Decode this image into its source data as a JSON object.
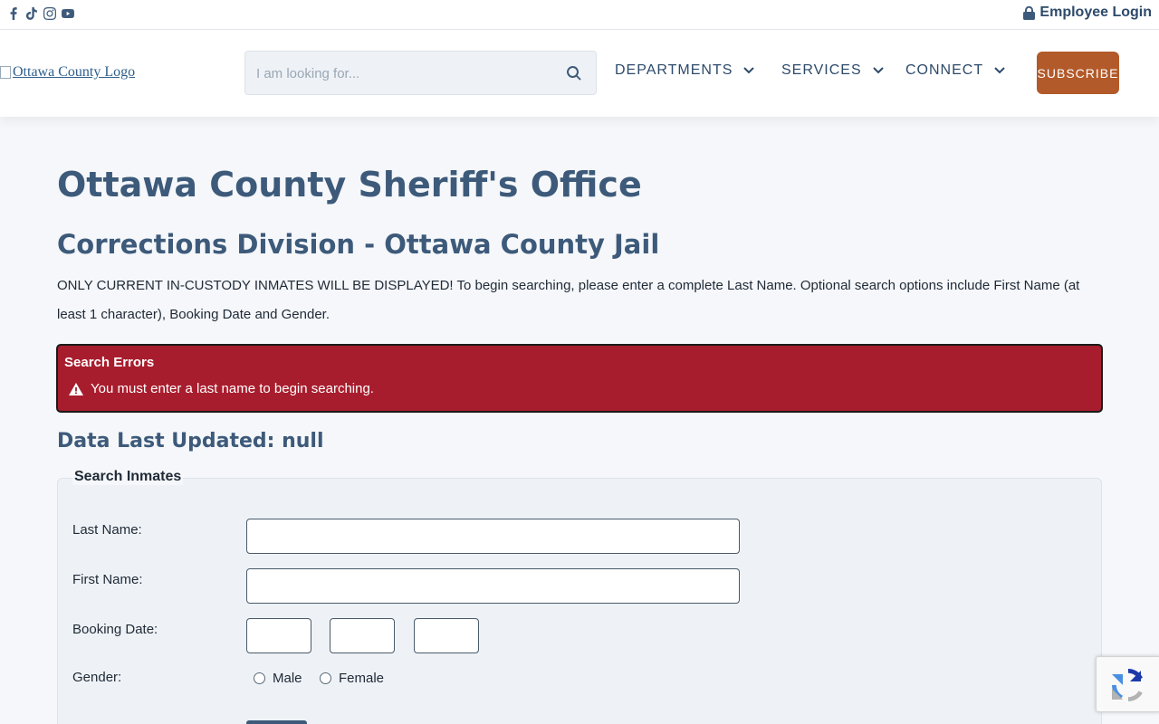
{
  "topbar": {
    "social_icons": [
      "facebook-icon",
      "tiktok-icon",
      "instagram-icon",
      "youtube-icon"
    ],
    "employee_login": "Employee Login"
  },
  "header": {
    "logo_alt": "Ottawa County Logo",
    "search_placeholder": "I am looking for...",
    "nav": [
      {
        "label": "DEPARTMENTS"
      },
      {
        "label": "SERVICES"
      },
      {
        "label": "CONNECT"
      }
    ],
    "subscribe": "SUBSCRIBE"
  },
  "main": {
    "title": "Ottawa County Sheriff's Office",
    "subtitle": "Corrections Division - Ottawa County Jail",
    "intro": "ONLY CURRENT IN-CUSTODY INMATES WILL BE DISPLAYED! To begin searching, please enter a complete Last Name. Optional search options include First Name (at least 1 character), Booking Date and Gender.",
    "error": {
      "title": "Search Errors",
      "message": "You must enter a last name to begin searching."
    },
    "updated": "Data Last Updated: null",
    "form": {
      "legend": "Search Inmates",
      "last_name_label": "Last Name:",
      "last_name_value": "",
      "first_name_label": "First Name:",
      "first_name_value": "",
      "booking_date_label": "Booking Date:",
      "gender_label": "Gender:",
      "gender_options": [
        "Male",
        "Female"
      ]
    }
  },
  "colors": {
    "heading": "#3d5a7a",
    "error_bg": "#a81d2d",
    "subscribe_bg": "#b35a2a"
  }
}
